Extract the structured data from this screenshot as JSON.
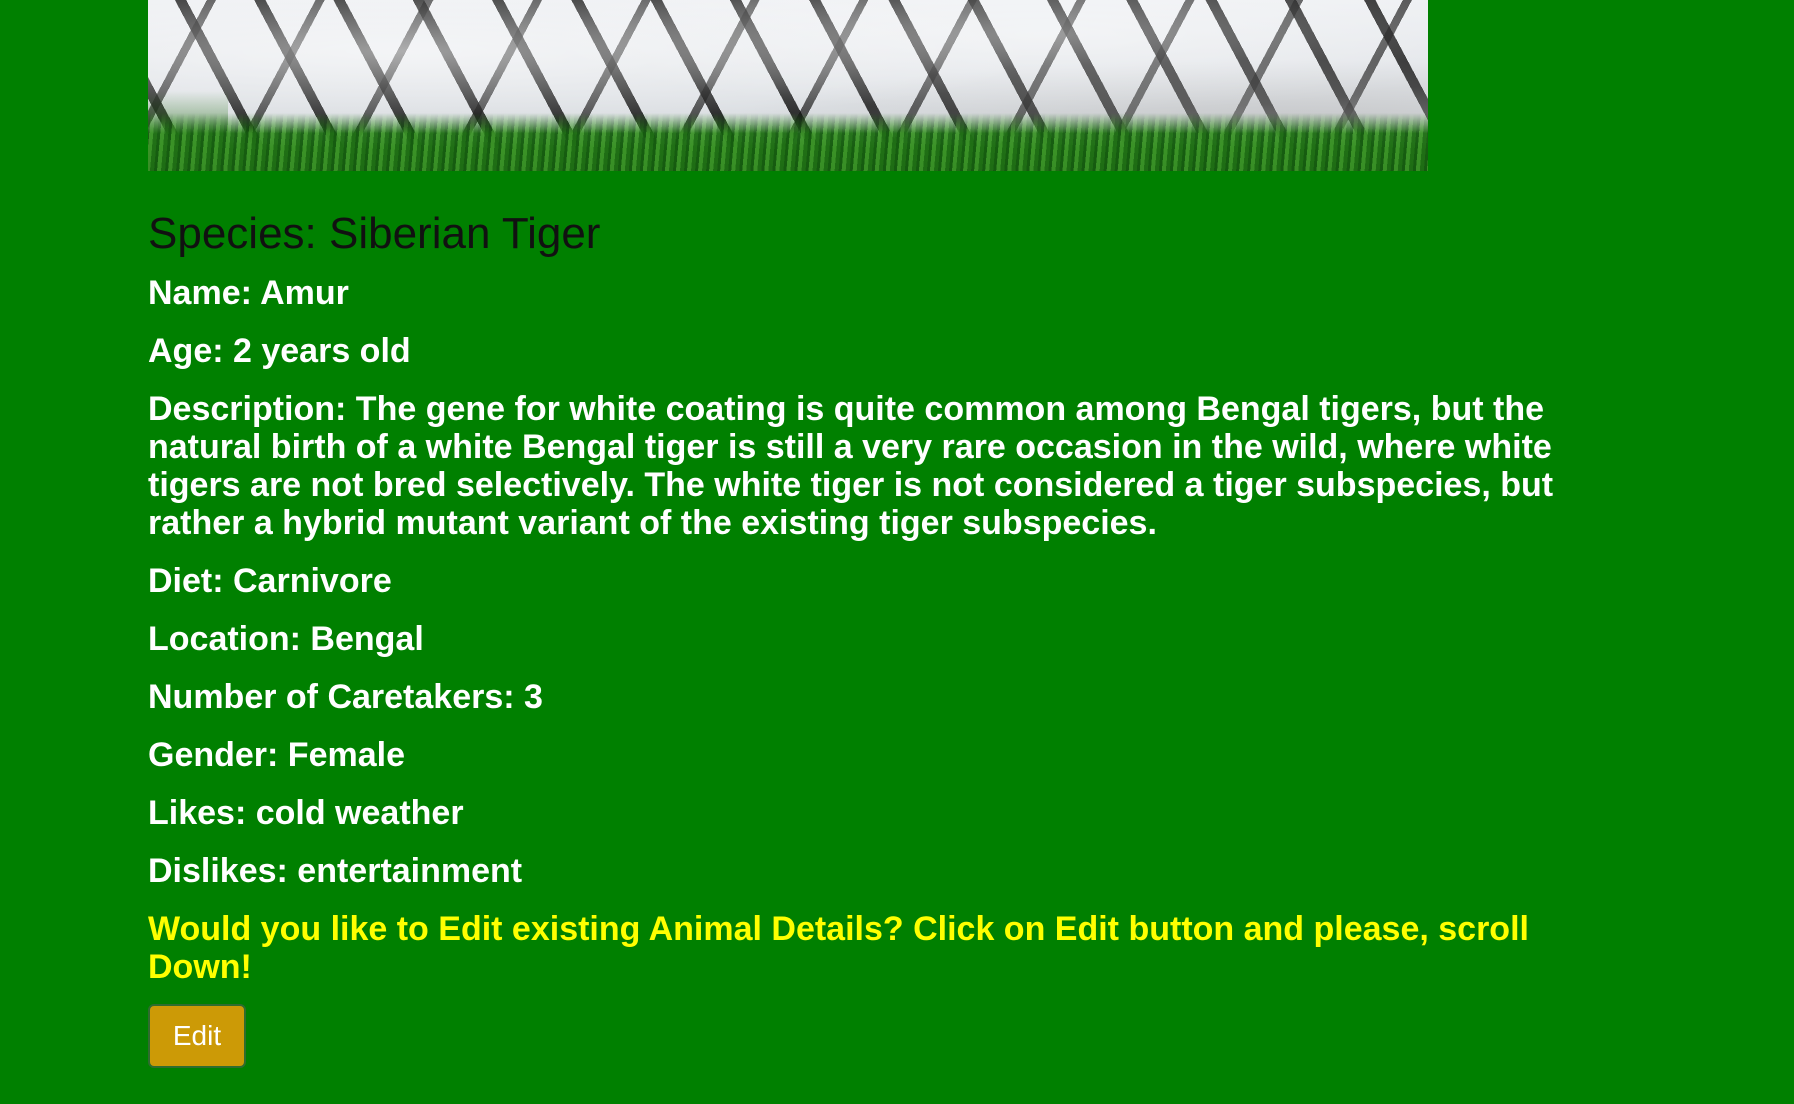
{
  "colors": {
    "page_background": "#008000",
    "heading_text": "#111111",
    "detail_text": "#ffffff",
    "prompt_text": "#ffff00",
    "edit_button_background": "#cc9a06"
  },
  "photo": {
    "subject": "white tiger lying on grass"
  },
  "animal": {
    "species": "Species: Siberian Tiger",
    "name_label": "Name: ",
    "name_value": "Amur",
    "age": "Age: 2 years old",
    "description": "Description: The gene for white coating is quite common among Bengal tigers, but the natural birth of a white Bengal tiger is still a very rare occasion in the wild, where white tigers are not bred selectively. The white tiger is not considered a tiger subspecies, but rather a hybrid mutant variant of the existing tiger subspecies.",
    "diet": "Diet: Carnivore",
    "location": "Location: Bengal",
    "caretakers": "Number of Caretakers: 3",
    "gender": "Gender: Female",
    "likes": "Likes: cold weather",
    "dislikes": "Dislikes: entertainment"
  },
  "prompt": "Would you like to Edit existing Animal Details? Click on Edit button and please, scroll Down!",
  "edit_button_label": "Edit"
}
